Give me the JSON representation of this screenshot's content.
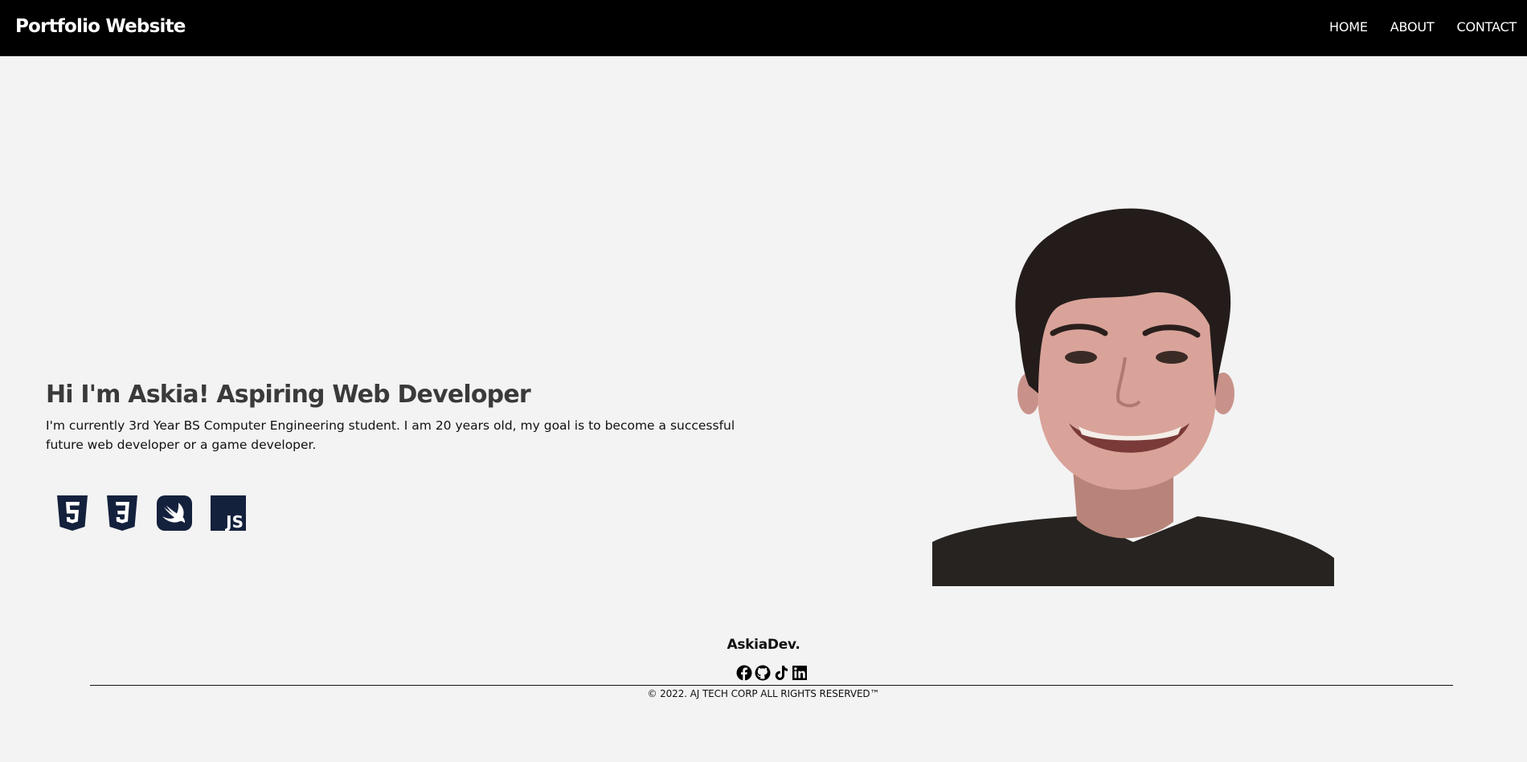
{
  "navbar": {
    "brand": "Portfolio Website",
    "links": [
      "HOME",
      "ABOUT",
      "CONTACT"
    ]
  },
  "hero": {
    "title": "Hi I'm Askia! Aspiring Web Developer",
    "description": "I'm currently 3rd Year BS Computer Engineering student. I am 20 years old, my goal is to become a successful future web developer or a game developer.",
    "skill_icons": [
      "html5-icon",
      "css3-icon",
      "swift-icon",
      "javascript-icon"
    ],
    "js_badge_text": "JS"
  },
  "footer": {
    "brand": "AskiaDev.",
    "social_icons": [
      "facebook-icon",
      "github-icon",
      "tiktok-icon",
      "linkedin-icon"
    ],
    "copyright": "© 2022. AJ TECH CORP ALL RIGHTS RESERVED™"
  },
  "colors": {
    "navbar_bg": "#000000",
    "page_bg": "#f3f3f3",
    "skill_icon": "#14213d",
    "title": "#3a3a3a"
  }
}
